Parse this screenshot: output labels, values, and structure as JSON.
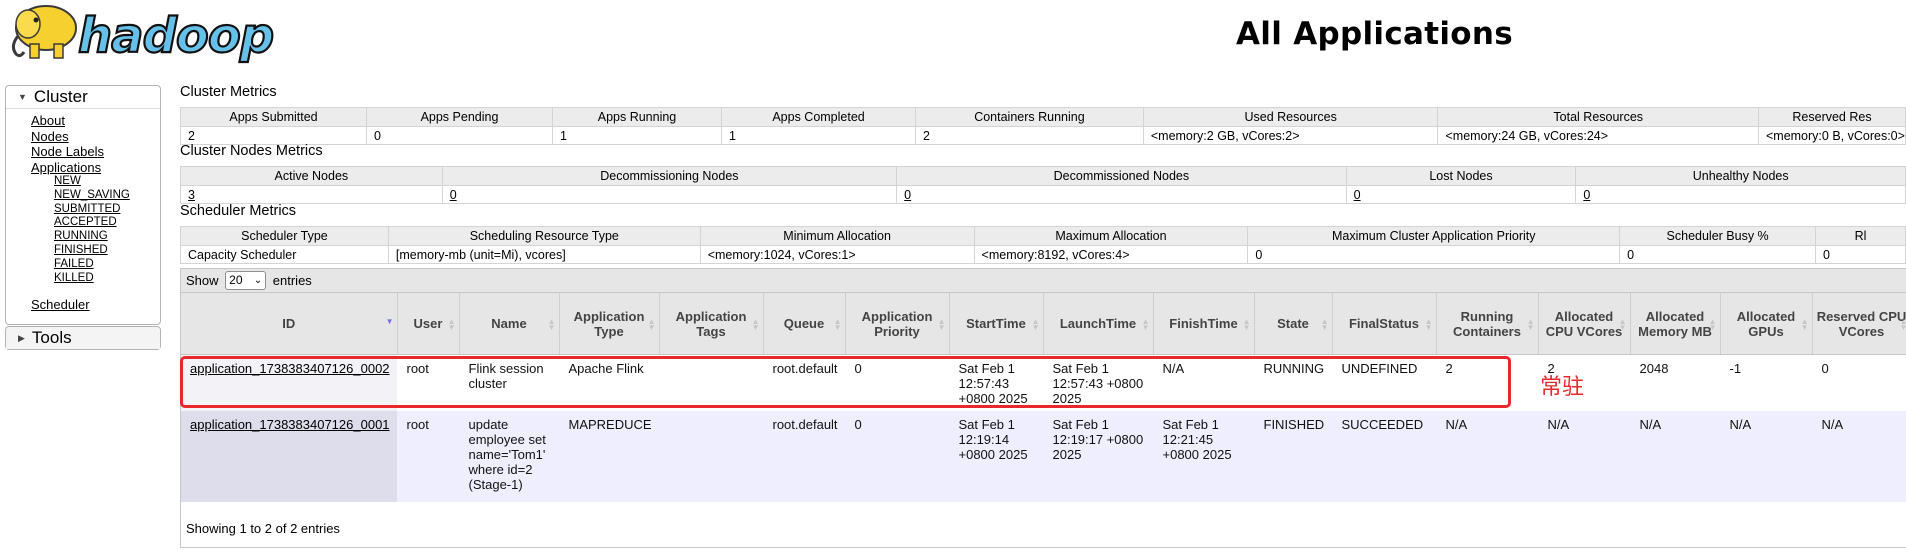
{
  "header": {
    "logo_text": "hadoop",
    "title": "All Applications"
  },
  "sidebar": {
    "cluster_label": "Cluster",
    "tools_label": "Tools",
    "items": [
      "About",
      "Nodes",
      "Node Labels",
      "Applications"
    ],
    "app_states": [
      "NEW",
      "NEW_SAVING",
      "SUBMITTED",
      "ACCEPTED",
      "RUNNING",
      "FINISHED",
      "FAILED",
      "KILLED"
    ],
    "scheduler": "Scheduler"
  },
  "cluster_metrics": {
    "title": "Cluster Metrics",
    "headers": [
      "Apps Submitted",
      "Apps Pending",
      "Apps Running",
      "Apps Completed",
      "Containers Running",
      "Used Resources",
      "Total Resources",
      "Reserved Res"
    ],
    "values": [
      "2",
      "0",
      "1",
      "1",
      "2",
      "<memory:2 GB, vCores:2>",
      "<memory:24 GB, vCores:24>",
      "<memory:0 B, vCores:0>"
    ]
  },
  "nodes_metrics": {
    "title": "Cluster Nodes Metrics",
    "headers": [
      "Active Nodes",
      "Decommissioning Nodes",
      "Decommissioned Nodes",
      "Lost Nodes",
      "Unhealthy Nodes"
    ],
    "values": [
      "3",
      "0",
      "0",
      "0",
      "0"
    ]
  },
  "scheduler_metrics": {
    "title": "Scheduler Metrics",
    "headers": [
      "Scheduler Type",
      "Scheduling Resource Type",
      "Minimum Allocation",
      "Maximum Allocation",
      "Maximum Cluster Application Priority",
      "Scheduler Busy %",
      "Rl"
    ],
    "values": [
      "Capacity Scheduler",
      "[memory-mb (unit=Mi), vcores]",
      "<memory:1024, vCores:1>",
      "<memory:8192, vCores:4>",
      "0",
      "0",
      "0"
    ]
  },
  "apps": {
    "show_label": "Show",
    "entries_label": "entries",
    "page_size": "20",
    "headers": [
      "ID",
      "User",
      "Name",
      "Application Type",
      "Application Tags",
      "Queue",
      "Application Priority",
      "StartTime",
      "LaunchTime",
      "FinishTime",
      "State",
      "FinalStatus",
      "Running Containers",
      "Allocated CPU VCores",
      "Allocated Memory MB",
      "Allocated GPUs",
      "Reserved CPU VCores"
    ],
    "rows": [
      [
        "application_1738383407126_0002",
        "root",
        "Flink session cluster",
        "Apache Flink",
        "",
        "root.default",
        "0",
        "Sat Feb 1 12:57:43 +0800 2025",
        "Sat Feb 1 12:57:43 +0800 2025",
        "N/A",
        "RUNNING",
        "UNDEFINED",
        "2",
        "2",
        "2048",
        "-1",
        "0"
      ],
      [
        "application_1738383407126_0001",
        "root",
        "update employee set name='Tom1' where id=2 (Stage-1)",
        "MAPREDUCE",
        "",
        "root.default",
        "0",
        "Sat Feb 1 12:19:14 +0800 2025",
        "Sat Feb 1 12:19:17 +0800 2025",
        "Sat Feb 1 12:21:45 +0800 2025",
        "FINISHED",
        "SUCCEEDED",
        "N/A",
        "N/A",
        "N/A",
        "N/A",
        "N/A"
      ]
    ],
    "footer": "Showing 1 to 2 of 2 entries"
  },
  "annotation": {
    "text": "常驻",
    "color": "#e8282c"
  }
}
